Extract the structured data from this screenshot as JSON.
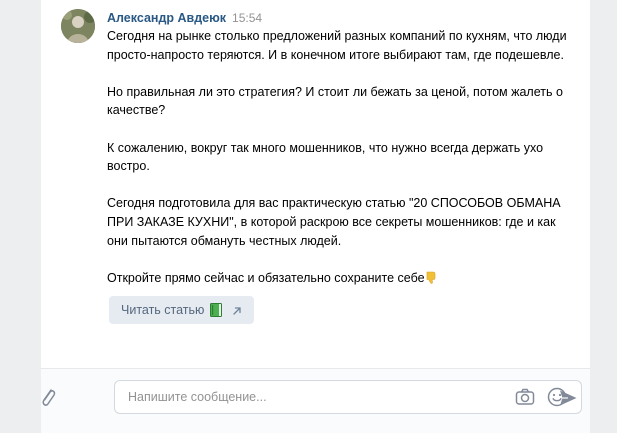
{
  "message": {
    "author": "Александр Авдеюк",
    "time": "15:54",
    "paragraphs": [
      "Сегодня на рынке столько предложений разных компаний по кухням, что люди просто-напросто теряются. И в конечном итоге выбирают там, где подешевле.",
      "Но правильная ли это стратегия? И стоит ли бежать за ценой, потом жалеть о качестве?",
      "К сожалению, вокруг так много мошенников, что нужно всегда держать ухо востро.",
      "Сегодня подготовила для вас практическую статью \"20 СПОСОБОВ ОБМАНА ПРИ ЗАКАЗЕ КУХНИ\", в которой раскрою все секреты мошенников: где и как они пытаются обмануть честных людей."
    ],
    "last_paragraph": "Откройте прямо сейчас и обязательно сохраните себе",
    "link_button_label": "Читать статью"
  },
  "composer": {
    "placeholder": "Напишите сообщение..."
  },
  "icons": {
    "thumb": "thumb-down-emoji",
    "book": "green-book-emoji",
    "arrow": "external-arrow-icon",
    "attach": "paperclip-icon",
    "camera": "camera-icon",
    "smile": "smile-icon",
    "send": "send-icon"
  },
  "colors": {
    "author": "#2a5885",
    "link_button_bg": "#e5ebf1",
    "link_button_text": "#55677d",
    "page_bg": "#edeef0",
    "icon_gray": "#828a99"
  }
}
